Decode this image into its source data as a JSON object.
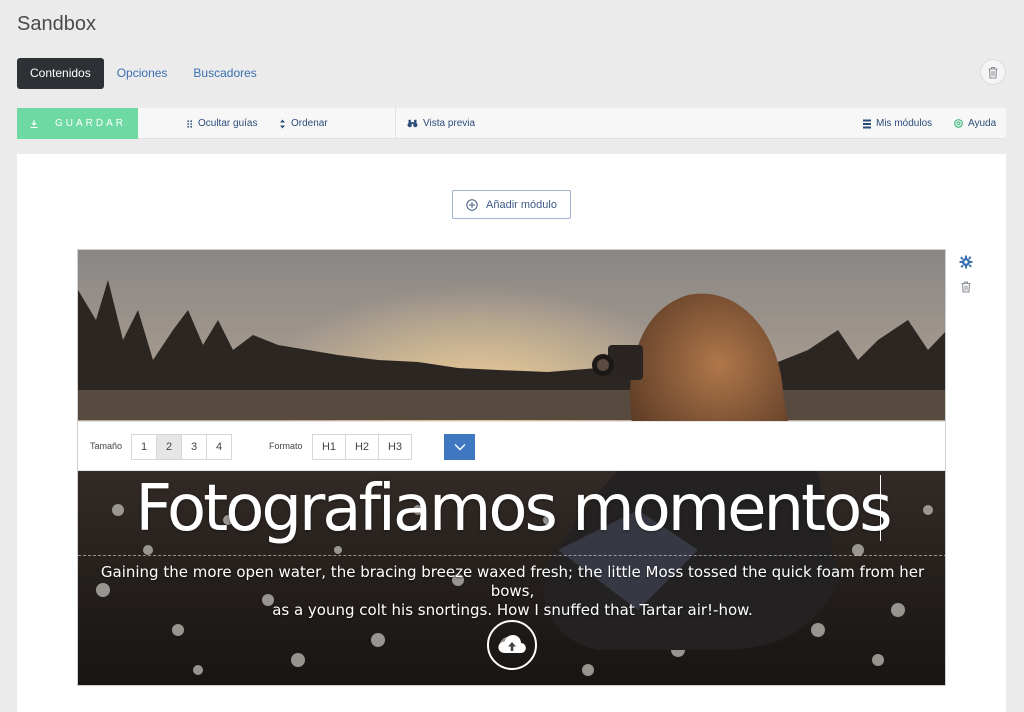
{
  "page": {
    "title": "Sandbox"
  },
  "tabs": [
    {
      "label": "Contenidos",
      "active": true
    },
    {
      "label": "Opciones",
      "active": false
    },
    {
      "label": "Buscadores",
      "active": false
    }
  ],
  "toolbar": {
    "save_label": "GUARDAR",
    "hide_guides_label": "Ocultar guías",
    "order_label": "Ordenar",
    "preview_label": "Vista previa",
    "my_modules_label": "Mis módulos",
    "help_label": "Ayuda"
  },
  "canvas": {
    "add_module_label": "Añadir módulo"
  },
  "editor": {
    "size_label": "Tamaño",
    "size_options": [
      "1",
      "2",
      "3",
      "4"
    ],
    "size_selected": "2",
    "format_label": "Formato",
    "format_options": [
      "H1",
      "H2",
      "H3"
    ]
  },
  "hero": {
    "headline": "Fotografiamos momentos",
    "subtext_line1": "Gaining the more open water, the bracing breeze waxed fresh; the little Moss tossed the quick foam from her bows,",
    "subtext_line2": "as a young colt his snortings. How I snuffed that Tartar air!-how."
  },
  "colors": {
    "save_green": "#6fd9a4",
    "tab_active_bg": "#2d3035",
    "link_blue": "#3a6fb0",
    "dropdown_blue": "#3f78c0"
  },
  "icons": {
    "save": "download-icon",
    "hide_guides": "dots-grid-icon",
    "order": "sort-arrows-icon",
    "preview": "binoculars-icon",
    "my_modules": "list-icon",
    "help": "help-circle-icon",
    "delete": "trash-icon",
    "add": "plus-circle-icon",
    "settings": "gear-icon",
    "upload": "cloud-upload-icon",
    "dropdown": "chevron-down-icon"
  }
}
